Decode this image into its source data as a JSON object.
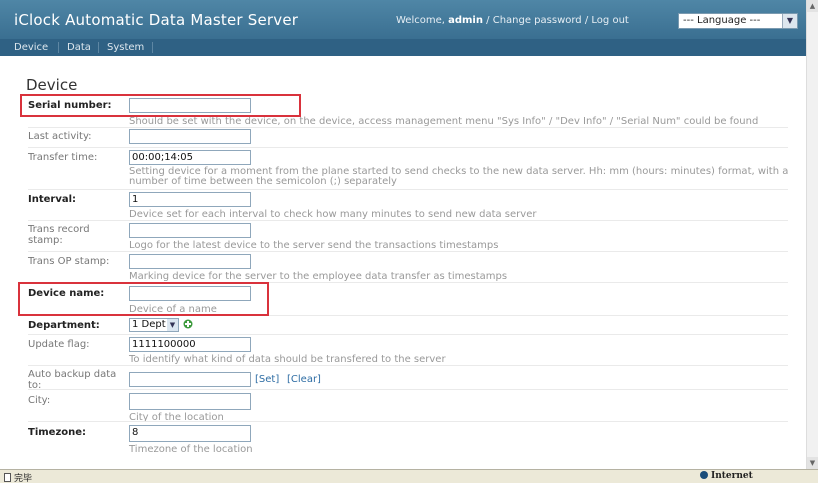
{
  "header": {
    "title": "iClock Automatic Data Master Server",
    "welcome_prefix": "Welcome, ",
    "username": "admin",
    "change_password": "Change password",
    "logout": "Log out",
    "separator": " / ",
    "language_label": "--- Language ---"
  },
  "nav": {
    "items": [
      {
        "label": "Device"
      },
      {
        "label": "Data"
      },
      {
        "label": "System"
      }
    ]
  },
  "page": {
    "title": "Device"
  },
  "form": {
    "serial_number": {
      "label": "Serial number:",
      "value": "",
      "hint": "Should be set with the device, on the device, access management menu \"Sys Info\" / \"Dev Info\" / \"Serial Num\" could be found"
    },
    "last_activity": {
      "label": "Last activity:",
      "value": ""
    },
    "transfer_time": {
      "label": "Transfer time:",
      "value": "00:00;14:05",
      "hint": "Setting device for a moment from the plane started to send checks to the new data server. Hh: mm (hours: minutes) format, with a number of time between the semicolon (;) separately"
    },
    "interval": {
      "label": "Interval:",
      "value": "1",
      "hint": "Device set for each interval to check how many minutes to send new data server"
    },
    "trans_record_stamp": {
      "label": "Trans record stamp:",
      "value": "",
      "hint": "Logo for the latest device to the server send the transactions timestamps"
    },
    "trans_op_stamp": {
      "label": "Trans OP stamp:",
      "value": "",
      "hint": "Marking device for the server to the employee data transfer as timestamps"
    },
    "device_name": {
      "label": "Device name:",
      "value": "",
      "hint": "Device of a name"
    },
    "department": {
      "label": "Department:",
      "value": "1 Dept"
    },
    "update_flag": {
      "label": "Update flag:",
      "value": "1111100000",
      "hint": "To identify what kind of data should be transfered to the server"
    },
    "auto_backup": {
      "label": "Auto backup data to:",
      "value": "",
      "set_label": "[Set]",
      "clear_label": "[Clear]"
    },
    "city": {
      "label": "City:",
      "value": "",
      "hint": "City of the location"
    },
    "timezone": {
      "label": "Timezone:",
      "value": "8",
      "hint": "Timezone of the location"
    }
  },
  "statusbar": {
    "left_text": "完毕",
    "zone_text": "Internet"
  },
  "colors": {
    "header_bg": "#3a6f91",
    "nav_bg": "#2f6184",
    "highlight_box": "#d9323c",
    "link": "#2e6da4"
  }
}
